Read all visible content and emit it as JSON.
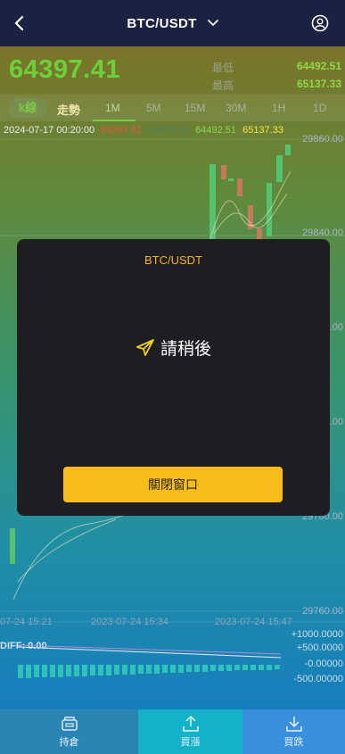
{
  "header": {
    "title": "BTC/USDT"
  },
  "ticker": {
    "price": "64397.41",
    "low_label": "最低",
    "low_value": "64492.51",
    "high_label": "最高",
    "high_value": "65137.33"
  },
  "view_tabs": {
    "kline": "k線",
    "trend": "走勢"
  },
  "periods": [
    "1M",
    "5M",
    "15M",
    "30M",
    "1H",
    "1D"
  ],
  "active_period": "1M",
  "ohlc": {
    "datetime": "2024-07-17 00:20:00",
    "open": "64397.41",
    "close": "65075.15",
    "low": "64492.51",
    "high": "65137.33"
  },
  "price_axis": [
    "29860.00",
    "29840.00",
    "29820.00",
    "29800.00",
    "29780.00",
    "29760.00"
  ],
  "time_axis": [
    "07-24 15:21",
    "2023-07-24 15:34",
    "2023-07-24 15:47"
  ],
  "macd": {
    "label": "DIFF: 0.00",
    "axis": [
      "+1000.0000",
      "+500.0000",
      "-0.00000",
      "-500.00000"
    ]
  },
  "modal": {
    "title": "BTC/USDT",
    "message": "請稍後",
    "close_label": "關閉窗口"
  },
  "tabbar": [
    {
      "label": "持倉",
      "icon": "wallet-icon"
    },
    {
      "label": "買漲",
      "icon": "upload-icon"
    },
    {
      "label": "買跌",
      "icon": "download-icon"
    }
  ],
  "colors": {
    "accent": "#f9bd1b",
    "up": "#55c26e",
    "down": "#c27b5b",
    "header": "#1b2140"
  }
}
